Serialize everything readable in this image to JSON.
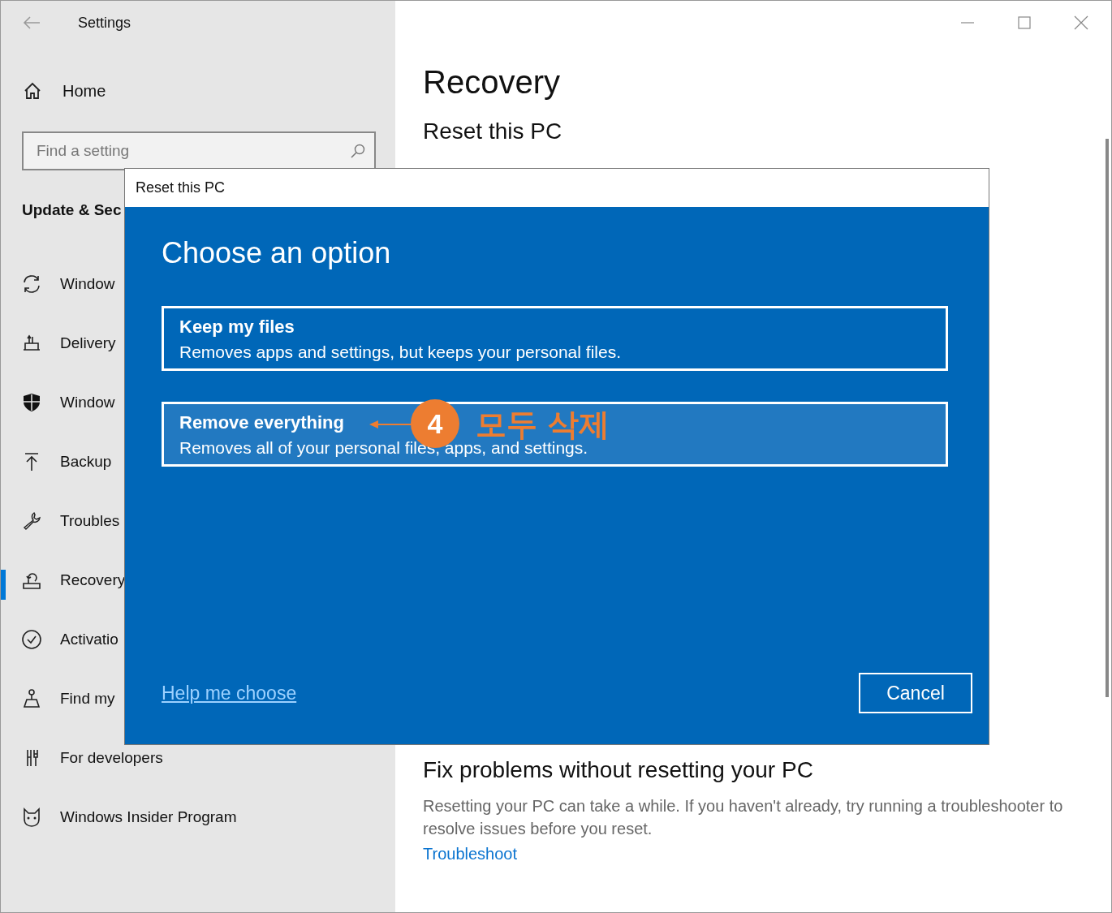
{
  "window": {
    "title": "Settings"
  },
  "sidebar": {
    "home": "Home",
    "search": {
      "placeholder": "Find a setting"
    },
    "section": "Update & Sec",
    "items": [
      {
        "label": "Window",
        "selected": false
      },
      {
        "label": "Delivery",
        "selected": false
      },
      {
        "label": "Window",
        "selected": false
      },
      {
        "label": "Backup",
        "selected": false
      },
      {
        "label": "Troubles",
        "selected": false
      },
      {
        "label": "Recovery",
        "selected": true
      },
      {
        "label": "Activatio",
        "selected": false
      },
      {
        "label": "Find my",
        "selected": false
      },
      {
        "label": "For developers",
        "selected": false
      },
      {
        "label": "Windows Insider Program",
        "selected": false
      }
    ]
  },
  "main": {
    "title": "Recovery",
    "reset_heading": "Reset this PC",
    "fix_heading": "Fix problems without resetting your PC",
    "fix_text": "Resetting your PC can take a while. If you haven't already, try running a troubleshooter to resolve issues before you reset.",
    "link": "Troubleshoot"
  },
  "dialog": {
    "title": "Reset this PC",
    "heading": "Choose an option",
    "options": [
      {
        "title": "Keep my files",
        "description": "Removes apps and settings, but keeps your personal files.",
        "selected": false
      },
      {
        "title": "Remove everything",
        "description": "Removes all of your personal files, apps, and settings.",
        "selected": true
      }
    ],
    "help_link": "Help me choose",
    "cancel": "Cancel"
  },
  "annotation": {
    "step": "4",
    "text": "모두 삭제"
  }
}
